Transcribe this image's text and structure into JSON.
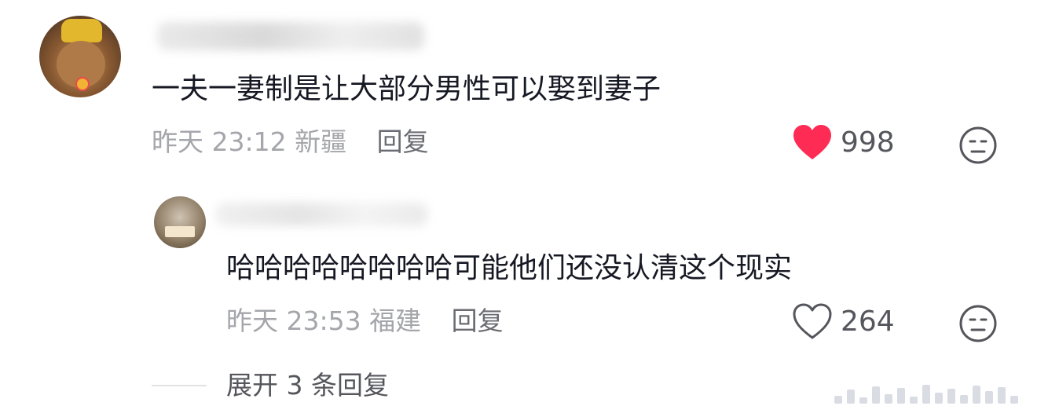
{
  "comments": [
    {
      "text": "一夫一妻制是让大部分男性可以娶到妻子",
      "time": "昨天 23:12",
      "location": "新疆",
      "reply_label": "回复",
      "likes": "998",
      "liked": true
    },
    {
      "text": "哈哈哈哈哈哈哈哈可能他们还没认清这个现实",
      "time": "昨天 23:53",
      "location": "福建",
      "reply_label": "回复",
      "likes": "264",
      "liked": false
    }
  ],
  "expand_replies": "展开 3 条回复",
  "colors": {
    "liked_heart": "#fe2c55",
    "meta_text": "#a5a6ab",
    "primary_text": "#161823"
  },
  "icons": [
    "heart-filled-icon",
    "heart-outline-icon",
    "dislike-face-icon"
  ]
}
